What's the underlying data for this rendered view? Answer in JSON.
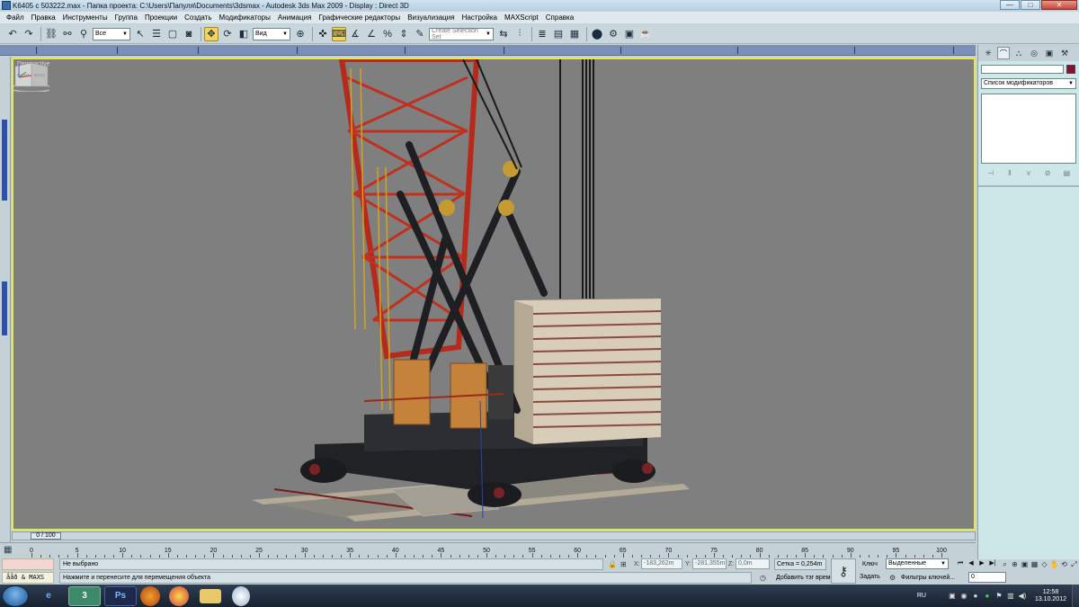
{
  "window": {
    "title": "K6405 с 503222.max     -  Папка проекта: C:\\Users\\Папуля\\Documents\\3dsmax     -  Autodesk 3ds Max  2009     -  Display : Direct 3D",
    "controls": [
      "—",
      "□",
      "✕"
    ]
  },
  "menu": {
    "items": [
      "Файл",
      "Правка",
      "Инструменты",
      "Группа",
      "Проекции",
      "Создать",
      "Модификаторы",
      "Анимация",
      "Графические редакторы",
      "Визуализация",
      "Настройка",
      "MAXScript",
      "Справка"
    ]
  },
  "toolbar": {
    "selection_filter": "Все",
    "reference_coord": "Вид",
    "named_selection_placeholder": "Create Selection Set"
  },
  "viewport": {
    "label": "Perspective",
    "viewcube_right": "RIGHT",
    "viewcube_back": "BACK",
    "border_color": "#e8e84a",
    "background": "#7f7f7f"
  },
  "timeslider": {
    "position": "0 / 100"
  },
  "trackbar": {
    "ticks": [
      "0",
      "5",
      "10",
      "15",
      "20",
      "25",
      "30",
      "35",
      "40",
      "45",
      "50",
      "55",
      "60",
      "65",
      "70",
      "75",
      "80",
      "85",
      "90",
      "95",
      "100"
    ]
  },
  "status": {
    "maxscript_label": "ååð & MAXS",
    "selection_text": "Не выбрано",
    "prompt_text": "Нажмите и перенесите для перемещения объекта",
    "x_label": "X:",
    "x_value": "-183,262m",
    "y_label": "Y:",
    "y_value": "-281,355m",
    "z_label": "Z:",
    "z_value": "0,0m",
    "grid_text": "Сетка = 0,254m",
    "add_time_tag": "Добавить тэг времени",
    "auto_key": "Ключ",
    "set_key": "Задать",
    "key_filter_select": "Выделенные",
    "key_filters": "Фильтры ключей...",
    "current_frame": "0"
  },
  "command_panel": {
    "modifier_list": "Список модификаторов",
    "object_color": "#8b1030"
  },
  "taskbar": {
    "apps": [
      "IE",
      "3ds",
      "Ps",
      "Firefox",
      "Chrome",
      "Folder",
      "Paint"
    ],
    "lang": "RU",
    "time": "12:58",
    "date": "13.10.2012"
  }
}
